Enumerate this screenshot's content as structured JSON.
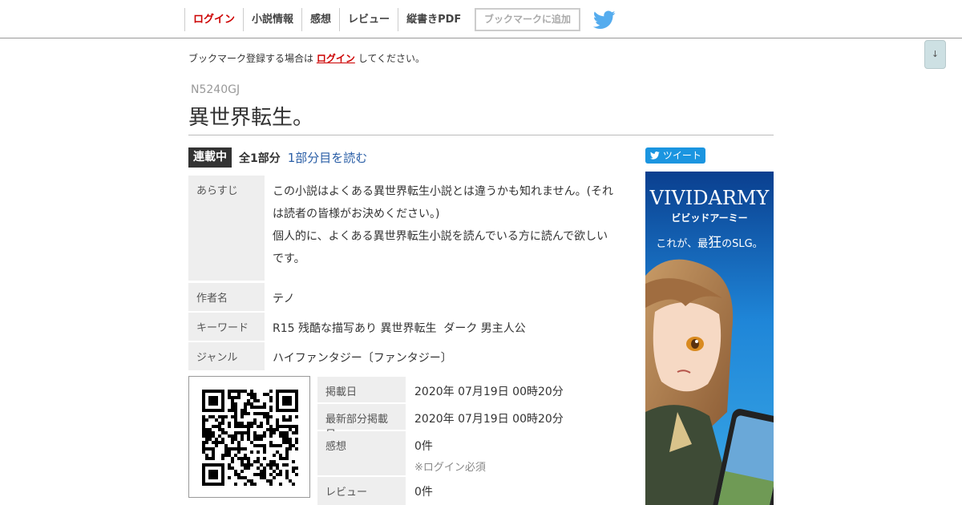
{
  "nav": {
    "items": [
      "ログイン",
      "小説情報",
      "感想",
      "レビュー",
      "縦書きPDF"
    ],
    "bookmark_button": "ブックマークに追加"
  },
  "scroll_button": "↓",
  "notice": {
    "before": "ブックマーク登録する場合は",
    "link": "ログイン",
    "after": "してください。"
  },
  "novel": {
    "ncode": "N5240GJ",
    "title": "異世界転生。",
    "status": "連載中",
    "parts": "全1部分",
    "read_link": "1部分目を読む"
  },
  "info": {
    "synopsis_label": "あらすじ",
    "synopsis_lines": [
      "この小説はよくある異世界転生小説とは違うかも知れません。(それ",
      "は読者の皆様がお決めください。)",
      "個人的に、よくある異世界転生小説を読んでいる方に読んで欲しい",
      "です。"
    ],
    "author_label": "作者名",
    "author": "テノ",
    "keyword_label": "キーワード",
    "keywords": "R15 残酷な描写あり 異世界転生  ダーク 男主人公",
    "genre_label": "ジャンル",
    "genre": "ハイファンタジー〔ファンタジー〕"
  },
  "details": {
    "posted_label": "掲載日",
    "posted": "2020年 07月19日 00時20分",
    "latest_label": "最新部分掲載日",
    "latest": "2020年 07月19日 00時20分",
    "impressions_label": "感想",
    "impressions": "0件",
    "login_required": "※ログイン必須",
    "review_label": "レビュー",
    "review": "0件"
  },
  "tweet_button": "ツイート",
  "ad": {
    "brand": "VIVIDARMY",
    "brand_kana": "ビビッドアーミー",
    "tagline_a": "これが、最",
    "tagline_b": "狂",
    "tagline_c": "のSLG。"
  },
  "colors": {
    "accent_red": "#cc0000",
    "link_blue": "#2a5ea6",
    "twitter_blue": "#1da1f2",
    "badge_dark": "#333333",
    "label_bg": "#eeeeee"
  }
}
